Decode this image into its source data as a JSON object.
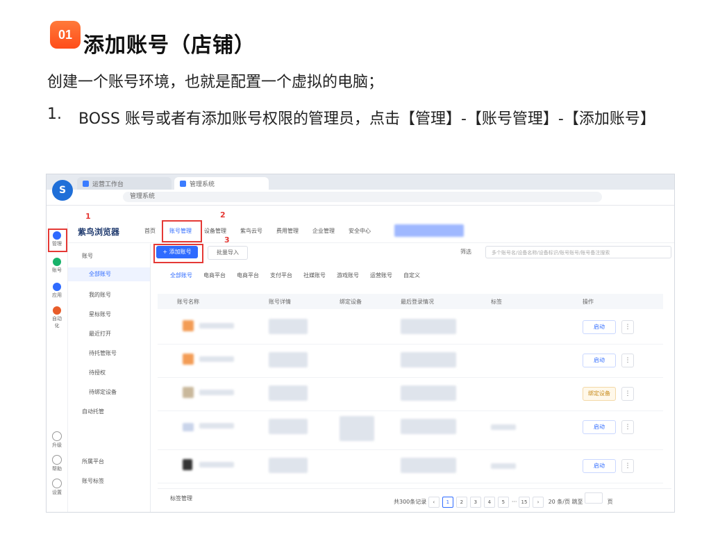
{
  "section": {
    "badge": "01",
    "title": "添加账号（店铺）"
  },
  "intro": "创建一个账号环境，也就是配置一个虚拟的电脑；",
  "step": {
    "number": "1.",
    "text": "BOSS 账号或者有添加账号权限的管理员，点击【管理】-【账号管理】-【添加账号】"
  },
  "screenshot": {
    "tabs": [
      "运营工作台",
      "管理系统"
    ],
    "url": "管理系统",
    "left_icons": [
      "管理",
      "账号",
      "应用",
      "自动化",
      "升级",
      "帮助",
      "设置"
    ],
    "brand": "紫鸟浏览器",
    "top_nav": [
      "首页",
      "账号管理",
      "设备管理",
      "紫鸟云号",
      "费用管理",
      "企业管理",
      "安全中心"
    ],
    "sidebar": {
      "group": "账号",
      "items": [
        "全部账号",
        "我的账号",
        "星标账号",
        "最近打开",
        "待托管账号",
        "待授权",
        "待绑定设备"
      ],
      "bottom": [
        "所属平台",
        "账号标签"
      ],
      "toggle": "自动托管"
    },
    "add_button": "+ 添加账号",
    "import_button": "批量导入",
    "filter_button": "筛选",
    "search_placeholder": "多个账号名/设备名称/设备标识/账号账号/账号备注搜索",
    "filter_tabs": [
      "全部账号",
      "电商平台",
      "电商平台",
      "支付平台",
      "社媒账号",
      "游戏账号",
      "运营账号",
      "自定义"
    ],
    "table_headers": [
      "账号名称",
      "账号详情",
      "绑定设备",
      "最后登录情况",
      "标签",
      "操作"
    ],
    "row_actions": [
      "启动",
      "启动",
      "绑定设备",
      "启动",
      "启动"
    ],
    "footer_left": "标签管理",
    "footer_total": "共300条记录",
    "pages": [
      "1",
      "2",
      "3",
      "4",
      "5",
      "···",
      "15"
    ],
    "per_page": "20 条/页",
    "goto": "跳至",
    "goto_unit": "页",
    "annotations": [
      "1",
      "2",
      "3"
    ]
  },
  "colors": {
    "accent": "#2f6bff",
    "badge": "#ff5a1f",
    "highlight": "#e53935"
  }
}
